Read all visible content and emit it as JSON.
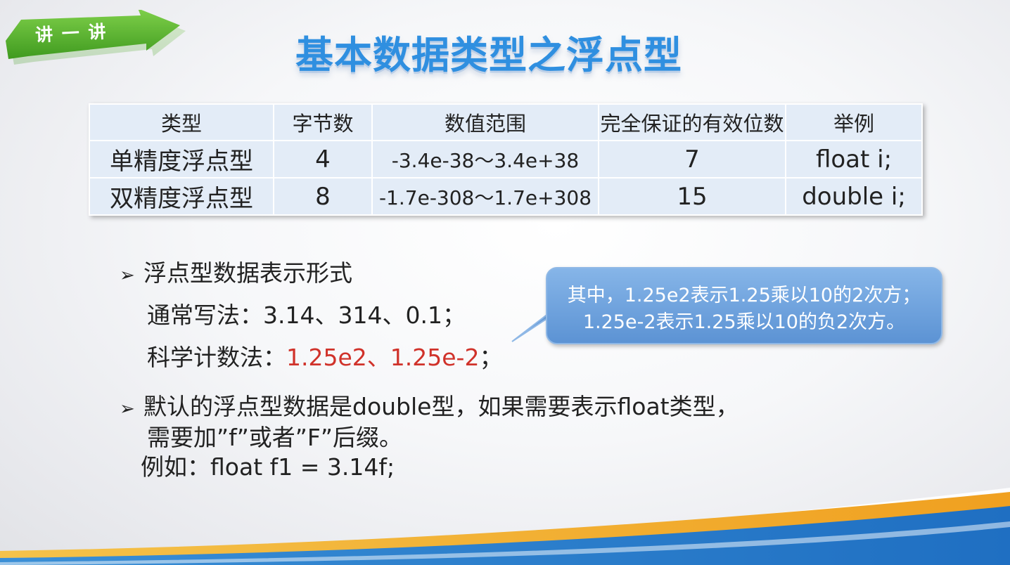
{
  "badge": {
    "label": "讲 一 讲"
  },
  "title": "基本数据类型之浮点型",
  "table": {
    "headers": [
      "类型",
      "字节数",
      "数值范围",
      "完全保证的有效位数",
      "举例"
    ],
    "rows": [
      [
        "单精度浮点型",
        "4",
        "-3.4e-38～3.4e+38",
        "7",
        "float i;"
      ],
      [
        "双精度浮点型",
        "8",
        "-1.7e-308～1.7e+308",
        "15",
        "double i;"
      ]
    ]
  },
  "section1": {
    "bullet": "浮点型数据表示形式",
    "normal_prefix": "通常写法：",
    "normal_values": "3.14、314、0.1；",
    "sci_prefix": "科学计数法：",
    "sci_values": "1.25e2、1.25e-2",
    "sci_suffix": "；"
  },
  "callout": {
    "line1": "其中，1.25e2表示1.25乘以10的2次方；",
    "line2": "1.25e-2表示1.25乘以10的负2次方。"
  },
  "section2": {
    "bullet": "默认的浮点型数据是double型，如果需要表示float类型，",
    "line2": "需要加”f”或者”F”后缀。",
    "line3": "例如：float f1 = 3.14f;"
  },
  "colors": {
    "title": "#2f8fe0",
    "accent_red": "#d0322a",
    "badge_green": "#5cb82f",
    "callout_blue": "#6fa3de",
    "table_fill": "#e3ecf7"
  }
}
